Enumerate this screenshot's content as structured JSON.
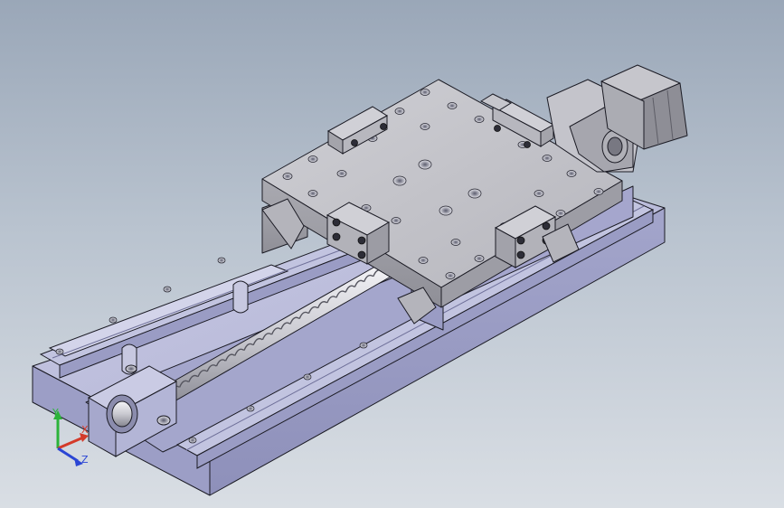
{
  "viewport": {
    "background_top": "#9aa7b8",
    "background_bottom": "#d9dee4"
  },
  "model": {
    "body_color": "#b7b9d8",
    "body_shadow": "#9596bb",
    "edge_color": "#1b1b24"
  },
  "triad": {
    "x_label": "X",
    "y_label": "Y",
    "z_label": "Z",
    "x_color": "#d43a2a",
    "y_color": "#2bb33a",
    "z_color": "#2a45d4"
  }
}
